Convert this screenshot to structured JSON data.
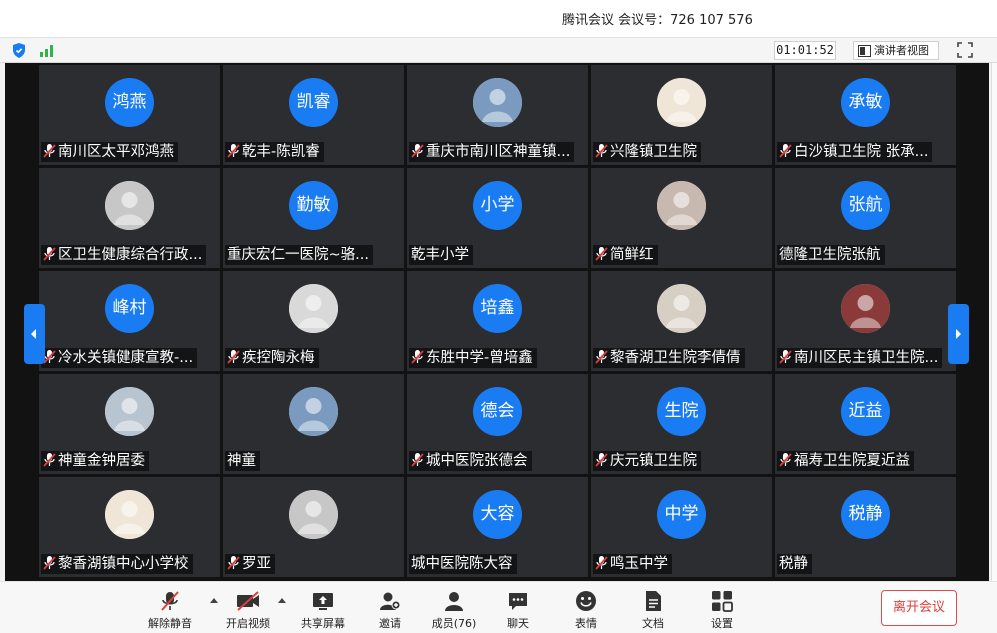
{
  "window": {
    "title": "腾讯会议 会议号：726 107 576"
  },
  "topbar": {
    "timer": "01:01:52",
    "presenter_view_label": "演讲者视图"
  },
  "participants": [
    {
      "name": "南川区太平邓鸿燕",
      "avatar_text": "鸿燕",
      "muted": true
    },
    {
      "name": "乾丰-陈凯睿",
      "avatar_text": "凯睿",
      "muted": true
    },
    {
      "name": "重庆市南川区神童镇...",
      "avatar_text": "",
      "muted": true
    },
    {
      "name": "兴隆镇卫生院",
      "avatar_text": "",
      "muted": true
    },
    {
      "name": "白沙镇卫生院 张承...",
      "avatar_text": "承敏",
      "muted": true
    },
    {
      "name": "区卫生健康综合行政...",
      "avatar_text": "",
      "muted": true
    },
    {
      "name": "重庆宏仁一医院~骆...",
      "avatar_text": "勤敏",
      "muted": false
    },
    {
      "name": "乾丰小学",
      "avatar_text": "小学",
      "muted": false
    },
    {
      "name": "简鲜红",
      "avatar_text": "",
      "muted": true
    },
    {
      "name": "德隆卫生院张航",
      "avatar_text": "张航",
      "muted": false
    },
    {
      "name": "冷水关镇健康宣教-...",
      "avatar_text": "峰村",
      "muted": true
    },
    {
      "name": "疾控陶永梅",
      "avatar_text": "",
      "muted": true
    },
    {
      "name": "东胜中学-曾培鑫",
      "avatar_text": "培鑫",
      "muted": true
    },
    {
      "name": "黎香湖卫生院李倩倩",
      "avatar_text": "",
      "muted": true
    },
    {
      "name": "南川区民主镇卫生院...",
      "avatar_text": "",
      "muted": true
    },
    {
      "name": "神童金钟居委",
      "avatar_text": "",
      "muted": true
    },
    {
      "name": "神童",
      "avatar_text": "",
      "muted": false
    },
    {
      "name": "城中医院张德会",
      "avatar_text": "德会",
      "muted": true
    },
    {
      "name": "庆元镇卫生院",
      "avatar_text": "生院",
      "muted": true
    },
    {
      "name": "福寿卫生院夏近益",
      "avatar_text": "近益",
      "muted": true
    },
    {
      "name": "黎香湖镇中心小学校",
      "avatar_text": "",
      "muted": true
    },
    {
      "name": "罗亚",
      "avatar_text": "",
      "muted": true
    },
    {
      "name": "城中医院陈大容",
      "avatar_text": "大容",
      "muted": false
    },
    {
      "name": "鸣玉中学",
      "avatar_text": "中学",
      "muted": true
    },
    {
      "name": "税静",
      "avatar_text": "税静",
      "muted": false
    }
  ],
  "toolbar": {
    "unmute": "解除静音",
    "start_video": "开启视频",
    "share_screen": "共享屏幕",
    "invite": "邀请",
    "members": "成员(76)",
    "chat": "聊天",
    "emoji": "表情",
    "docs": "文档",
    "settings": "设置",
    "leave": "离开会议"
  },
  "colors": {
    "avatar_blue": "#1a7cf2",
    "tile_bg": "#2c2d31",
    "leave_red": "#e03c3c"
  }
}
